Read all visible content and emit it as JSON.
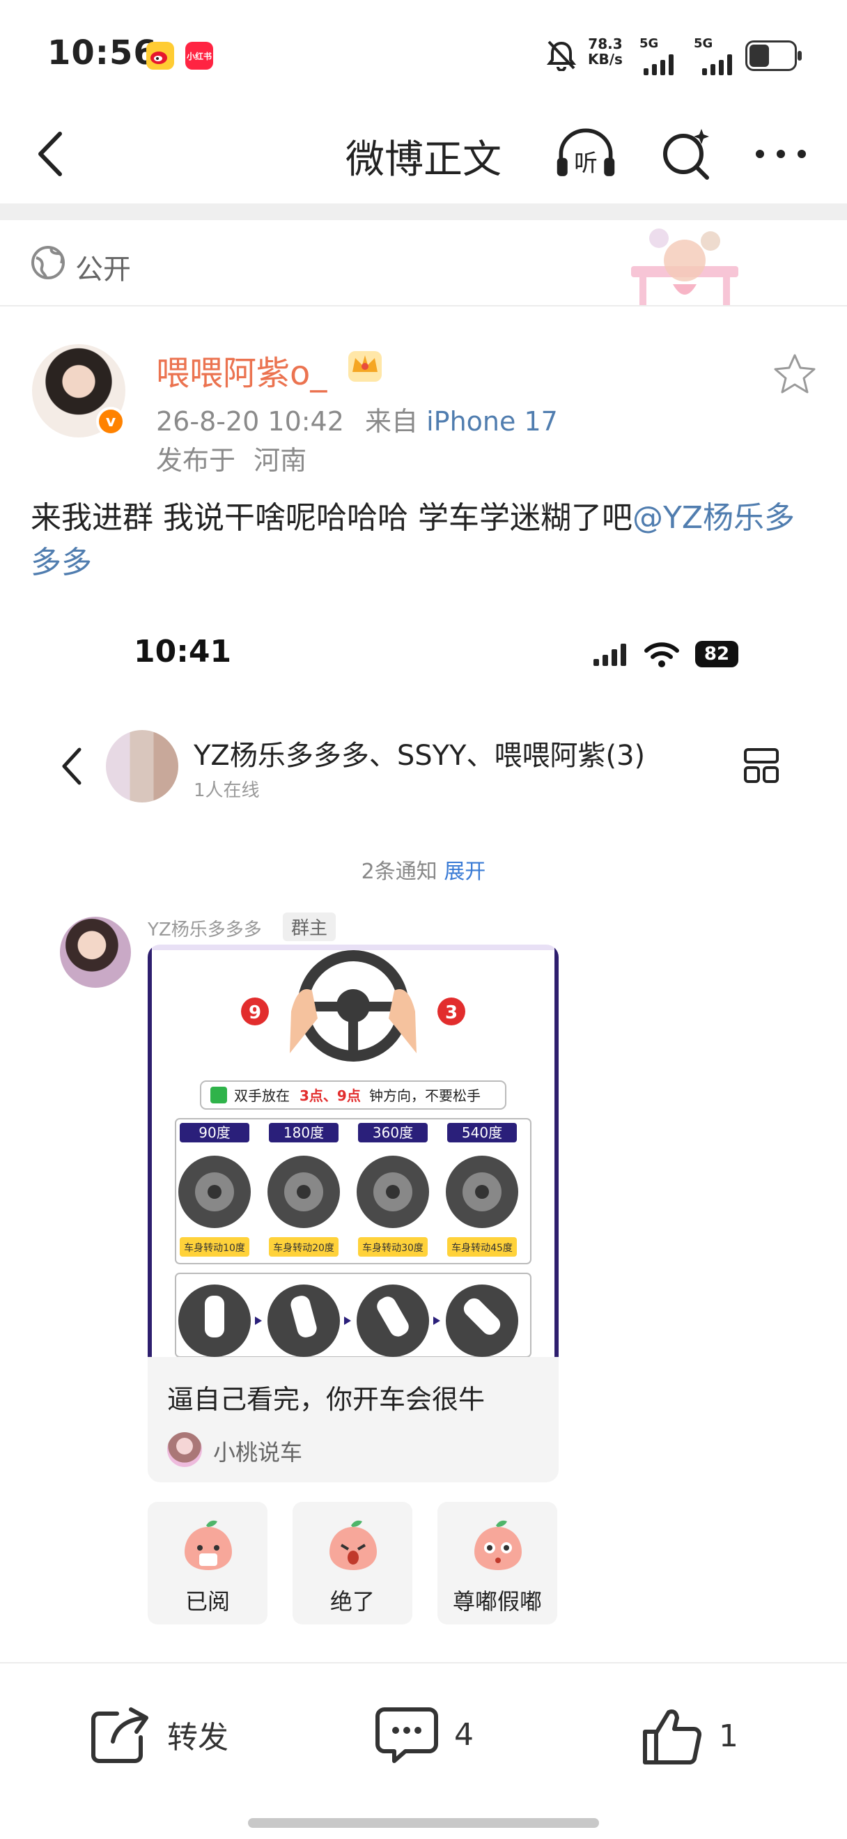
{
  "status_bar": {
    "time": "10:56",
    "apps": [
      "微博",
      "小红书"
    ],
    "speed_value": "78.3",
    "speed_unit": "KB/s",
    "sim1": "5G",
    "sim2": "5G"
  },
  "nav": {
    "title": "微博正文",
    "icons": [
      "back-icon",
      "listen-icon",
      "search-icon",
      "more-icon"
    ],
    "listen_glyph": "听"
  },
  "visibility": {
    "label": "公开",
    "icon": "globe-icon"
  },
  "post": {
    "user_name": "喂喂阿紫o_",
    "time": "26-8-20 10:42",
    "from_prefix": "来自",
    "source": "iPhone 17",
    "location_prefix": "发布于",
    "location": "河南",
    "text": "来我进群 我说干啥呢哈哈哈 学车学迷糊了吧",
    "mention": "@YZ杨乐多多多"
  },
  "embedded": {
    "time": "10:41",
    "battery": "82",
    "group_name": "YZ杨乐多多多、SSYY、喂喂阿紫(3)",
    "online": "1人在线",
    "notice_text": "2条通知",
    "notice_action": "展开",
    "sender": "YZ杨乐多多多",
    "sender_role": "群主",
    "card": {
      "image_labels": {
        "left_num": "9",
        "right_num": "3",
        "banner_a": "双手放在",
        "banner_b": "3点、9点",
        "banner_c": "钟方向，不要松手",
        "degrees": [
          "90度",
          "180度",
          "360度",
          "540度"
        ],
        "turns": [
          "车身转动10度",
          "车身转动20度",
          "车身转动30度",
          "车身转动45度"
        ]
      },
      "title": "逼自己看完，你开车会很牛",
      "source": "小桃说车"
    },
    "reactions": [
      {
        "label": "已阅"
      },
      {
        "label": "绝了"
      },
      {
        "label": "尊嘟假嘟"
      }
    ]
  },
  "bottom_bar": {
    "repost_label": "转发",
    "comment_count": "4",
    "like_count": "1"
  },
  "colors": {
    "username": "#eb7350",
    "link": "#507daf",
    "accent_blue": "#3a7bd5",
    "verified": "#ff8200"
  }
}
